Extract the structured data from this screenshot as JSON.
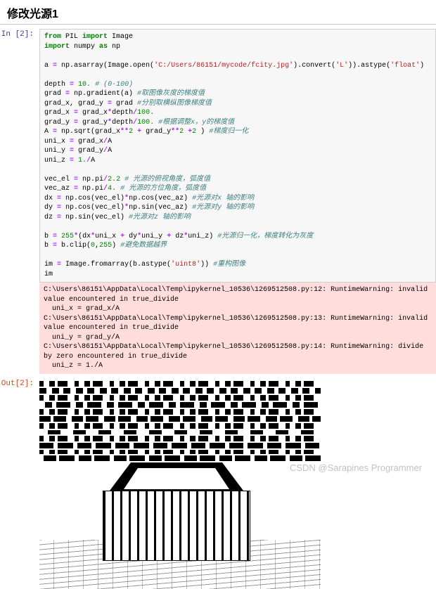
{
  "header": {
    "title": "修改光源1"
  },
  "prompts": {
    "in": "In [2]:",
    "out": "Out[2]:"
  },
  "code": {
    "l1a": "from",
    "l1b": " PIL ",
    "l1c": "import",
    "l1d": " Image",
    "l2a": "import",
    "l2b": " numpy ",
    "l2c": "as",
    "l2d": " np",
    "l3": " ",
    "l4a": "a ",
    "l4b": "=",
    "l4c": " np.asarray(Image.open(",
    "l4d": "'C:/Users/86151/mycode/fcity.jpg'",
    "l4e": ").convert(",
    "l4f": "'L'",
    "l4g": ")).astype(",
    "l4h": "'float'",
    "l4i": ")",
    "l5": " ",
    "l6a": "depth ",
    "l6b": "=",
    "l6c": " ",
    "l6d": "10.",
    "l6e": " ",
    "l6f": "# (0-100)",
    "l7a": "grad ",
    "l7b": "=",
    "l7c": " np.gradient(a) ",
    "l7d": "#取图像灰度的梯度值",
    "l8a": "grad_x, grad_y ",
    "l8b": "=",
    "l8c": " grad ",
    "l8d": "#分别取横纵图像梯度值",
    "l9a": "grad_x ",
    "l9b": "=",
    "l9c": " grad_x",
    "l9d": "*",
    "l9e": "depth",
    "l9f": "/",
    "l9g": "100.",
    "l10a": "grad_y ",
    "l10b": "=",
    "l10c": " grad_y",
    "l10d": "*",
    "l10e": "depth",
    "l10f": "/",
    "l10g": "100.",
    "l10h": " ",
    "l10i": "#根据调整x，y的梯度值",
    "l11a": "A ",
    "l11b": "=",
    "l11c": " np.sqrt(grad_x",
    "l11d": "**",
    "l11e": "2",
    "l11f": " ",
    "l11g": "+",
    "l11h": " grad_y",
    "l11i": "**",
    "l11j": "2",
    "l11k": " ",
    "l11l": "+",
    "l11m": "2",
    "l11n": " ) ",
    "l11o": "#梯度归一化",
    "l12a": "uni_x ",
    "l12b": "=",
    "l12c": " grad_x",
    "l12d": "/",
    "l12e": "A",
    "l13a": "uni_y ",
    "l13b": "=",
    "l13c": " grad_y",
    "l13d": "/",
    "l13e": "A",
    "l14a": "uni_z ",
    "l14b": "=",
    "l14c": " ",
    "l14d": "1.",
    "l14e": "/",
    "l14f": "A",
    "l15": " ",
    "l16a": "vec_el ",
    "l16b": "=",
    "l16c": " np.pi",
    "l16d": "/",
    "l16e": "2.2",
    "l16f": " ",
    "l16g": "# 光源的俯视角度，弧度值",
    "l17a": "vec_az ",
    "l17b": "=",
    "l17c": " np.pi",
    "l17d": "/",
    "l17e": "4.",
    "l17f": " ",
    "l17g": "# 光源的方位角度，弧度值",
    "l18a": "dx ",
    "l18b": "=",
    "l18c": " np.cos(vec_el)",
    "l18d": "*",
    "l18e": "np.cos(vec_az) ",
    "l18f": "#光源对x 轴的影响",
    "l19a": "dy ",
    "l19b": "=",
    "l19c": " np.cos(vec_el)",
    "l19d": "*",
    "l19e": "np.sin(vec_az) ",
    "l19f": "#光源对y 轴的影响",
    "l20a": "dz ",
    "l20b": "=",
    "l20c": " np.sin(vec_el) ",
    "l20d": "#光源对z 轴的影响",
    "l21": " ",
    "l22a": "b ",
    "l22b": "=",
    "l22c": " ",
    "l22d": "255",
    "l22e": "*",
    "l22f": "(dx",
    "l22g": "*",
    "l22h": "uni_x ",
    "l22i": "+",
    "l22j": " dy",
    "l22k": "*",
    "l22l": "uni_y ",
    "l22m": "+",
    "l22n": " dz",
    "l22o": "*",
    "l22p": "uni_z) ",
    "l22q": "#光源归一化，梯度转化为灰度",
    "l23a": "b ",
    "l23b": "=",
    "l23c": " b.clip(",
    "l23d": "0",
    "l23e": ",",
    "l23f": "255",
    "l23g": ") ",
    "l23h": "#避免数据越界",
    "l24": " ",
    "l25a": "im ",
    "l25b": "=",
    "l25c": " Image.fromarray(b.astype(",
    "l25d": "'uint8'",
    "l25e": ")) ",
    "l25f": "#重构图像",
    "l26": "im"
  },
  "stderr": {
    "w1": "C:\\Users\\86151\\AppData\\Local\\Temp\\ipykernel_10536\\1269512508.py:12: RuntimeWarning: invalid value encountered in true_divide",
    "w1b": "  uni_x = grad_x/A",
    "w2": "C:\\Users\\86151\\AppData\\Local\\Temp\\ipykernel_10536\\1269512508.py:13: RuntimeWarning: invalid value encountered in true_divide",
    "w2b": "  uni_y = grad_y/A",
    "w3": "C:\\Users\\86151\\AppData\\Local\\Temp\\ipykernel_10536\\1269512508.py:14: RuntimeWarning: divide by zero encountered in true_divide",
    "w3b": "  uni_z = 1./A"
  },
  "watermark": "CSDN @Sarapines Programmer"
}
